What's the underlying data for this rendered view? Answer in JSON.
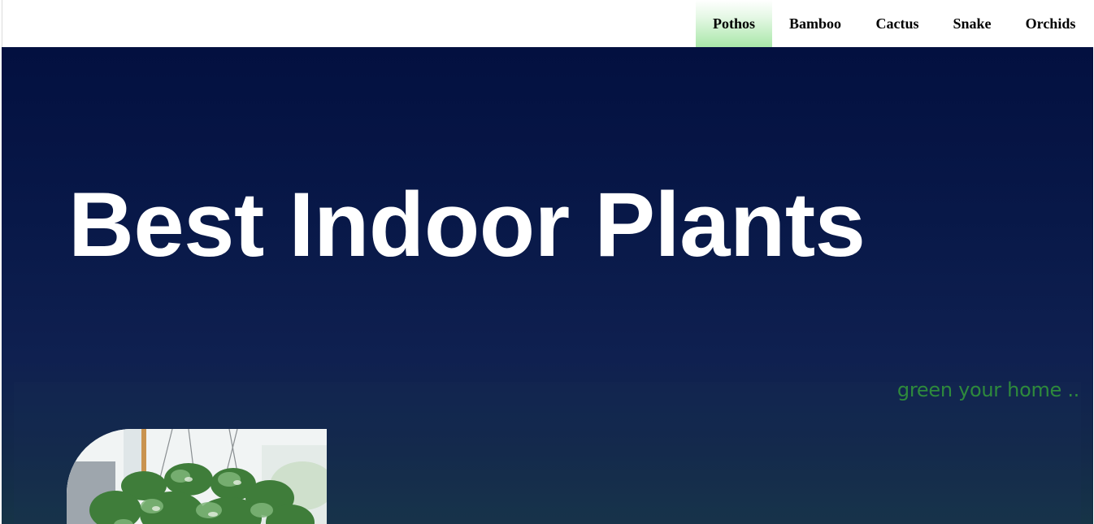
{
  "nav": {
    "items": [
      {
        "label": "Pothos",
        "active": true
      },
      {
        "label": "Bamboo",
        "active": false
      },
      {
        "label": "Cactus",
        "active": false
      },
      {
        "label": "Snake",
        "active": false
      },
      {
        "label": "Orchids",
        "active": false
      }
    ]
  },
  "hero": {
    "title": "Best Indoor Plants",
    "tagline": "green your home .."
  },
  "colors": {
    "nav_active_gradient_end": "#a9e7a9",
    "hero_bg_top": "#031040",
    "hero_bg_bottom": "#163447",
    "tagline": "#2e8a3c",
    "title": "#ffffff"
  },
  "images": {
    "plant_photo": "pothos-hanging-plant-image"
  }
}
